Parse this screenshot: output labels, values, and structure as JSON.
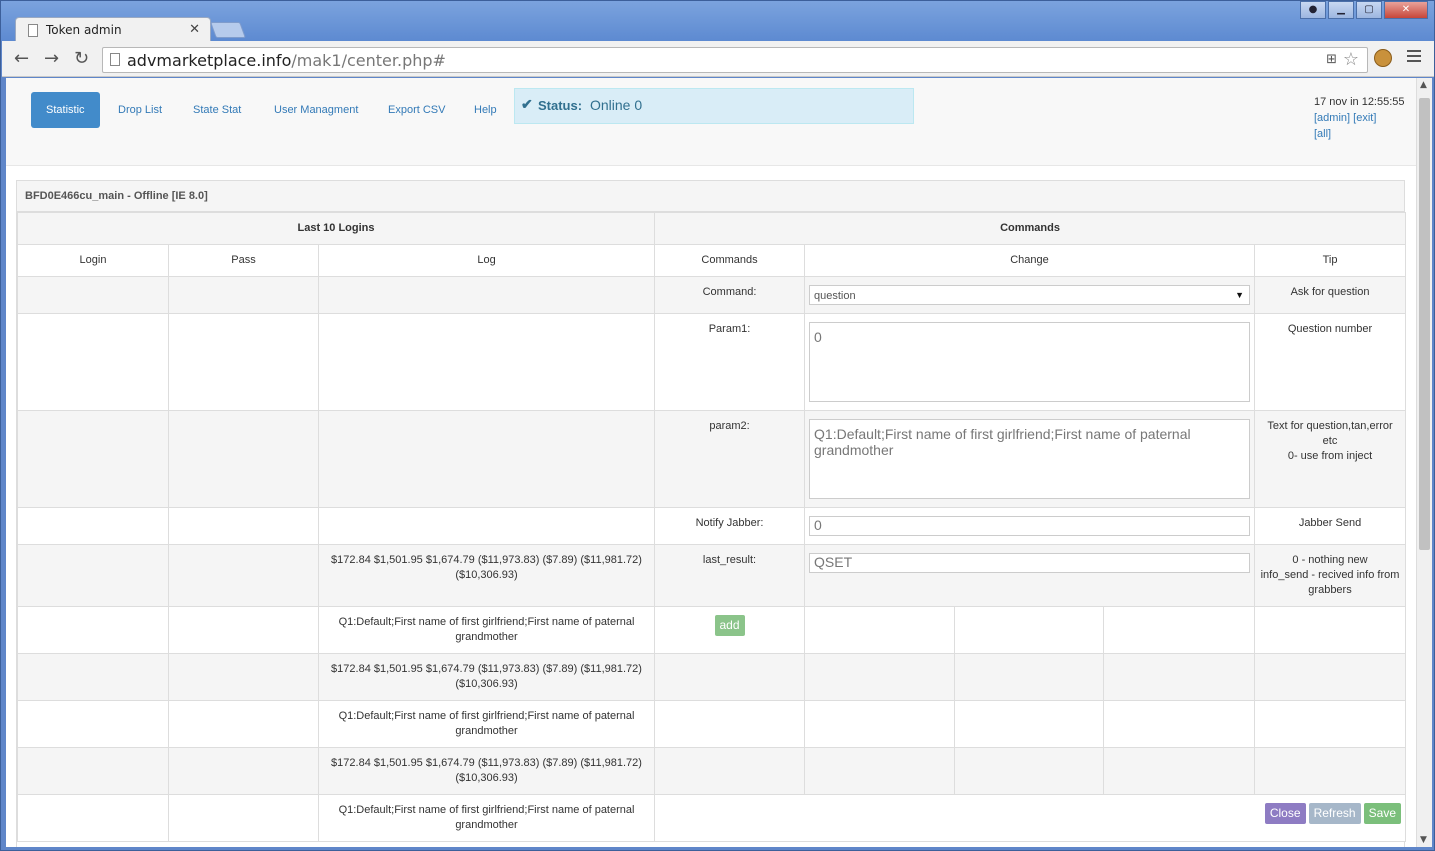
{
  "browser": {
    "tab_title": "Token admin",
    "tab_close": "✕",
    "url_host": "advmarketplace.info",
    "url_path": "/mak1/center.php#"
  },
  "nav": {
    "items": [
      {
        "label": "Statistic"
      },
      {
        "label": "Drop List"
      },
      {
        "label": "State Stat"
      },
      {
        "label": "User Managment"
      },
      {
        "label": "Export CSV"
      },
      {
        "label": "Help"
      }
    ],
    "status_label": "Status:",
    "status_value": "Online 0"
  },
  "userinfo": {
    "datetime": "17 nov in 12:55:55",
    "admin": "[admin]",
    "exit": "[exit]",
    "all": "[all]"
  },
  "panel": {
    "heading": "BFD0E466cu_main - Offline [IE 8.0]",
    "section_logins": "Last 10 Logins",
    "section_commands": "Commands",
    "col_login": "Login",
    "col_pass": "Pass",
    "col_log": "Log",
    "col_commands": "Commands",
    "col_change": "Change",
    "col_tip": "Tip"
  },
  "commands": {
    "command_label": "Command:",
    "command_value": "question",
    "command_tip": "Ask for question",
    "param1_label": "Param1:",
    "param1_value": "0",
    "param1_tip": "Question number",
    "param2_label": "param2:",
    "param2_value": "Q1:Default;First name of first girlfriend;First name of paternal grandmother",
    "param2_tip_line1": "Text for question,tan,error etc",
    "param2_tip_line2": "0- use from inject",
    "notify_label": "Notify Jabber:",
    "notify_value": "0",
    "notify_tip": "Jabber Send",
    "last_result_label": "last_result:",
    "last_result_value": "QSET",
    "last_result_tip_line1": "0 - nothing new",
    "last_result_tip_line2": "info_send - recived info from grabbers",
    "add_button": "add"
  },
  "logs": [
    "$172.84 $1,501.95 $1,674.79 ($11,973.83) ($7.89) ($11,981.72) ($10,306.93)",
    "Q1:Default;First name of first girlfriend;First name of paternal grandmother",
    "$172.84 $1,501.95 $1,674.79 ($11,973.83) ($7.89) ($11,981.72) ($10,306.93)",
    "Q1:Default;First name of first girlfriend;First name of paternal grandmother",
    "$172.84 $1,501.95 $1,674.79 ($11,973.83) ($7.89) ($11,981.72) ($10,306.93)",
    "Q1:Default;First name of first girlfriend;First name of paternal grandmother"
  ],
  "buttons": {
    "close": "Close",
    "refresh": "Refresh",
    "save": "Save"
  }
}
